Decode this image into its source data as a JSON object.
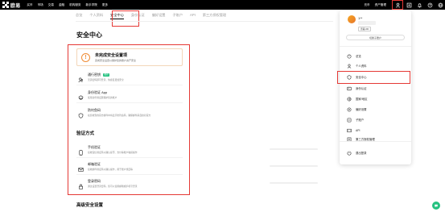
{
  "app": {
    "logo_text": "欧易",
    "nav": [
      "买币",
      "市场",
      "交易",
      "金融",
      "机构服务",
      "新手学院",
      "更多"
    ],
    "nav_right": [
      "充币",
      "资产管理"
    ]
  },
  "tabs": [
    "总览",
    "个人资料",
    "安全中心",
    "身份认证",
    "偏好设置",
    "子账户",
    "API",
    "第三方授权管理"
  ],
  "page_title": "安全中心",
  "warning": {
    "title": "未完成安全设置项",
    "desc": "完成安全设置以保护您的账户资产安全"
  },
  "security_items": [
    {
      "name": "通行密钥",
      "badge": "推荐",
      "desc": "无需密码即可登录，快捷且更加安全"
    },
    {
      "name": "身份验证 App",
      "badge": "",
      "desc": "使用身份验证器保护您的账户"
    },
    {
      "name": "防钓鱼码",
      "badge": "",
      "desc": "在您收到的官方邮件中将显示防钓鱼码，确保邮件来自欧易官方"
    }
  ],
  "verify_title": "验证方式",
  "verify_items": [
    {
      "name": "手机验证",
      "desc": "接收短信验证码以确认提币、支付等账户敏感操作"
    },
    {
      "name": "邮箱验证",
      "desc": "接收邮件验证码以确认操作，用于账户找回等"
    },
    {
      "name": "登录密码",
      "desc": "通过设置登录密码，您可以使用邮箱或手机号登录"
    }
  ],
  "advanced_title": "高级安全设置",
  "dropdown": {
    "name": "1**",
    "tag": "查看UID",
    "button": "切换子账户",
    "items": [
      {
        "icon": "overview-icon",
        "label": "总览"
      },
      {
        "icon": "profile-icon",
        "label": "个人资料"
      },
      {
        "icon": "shield-icon",
        "label": "安全中心"
      },
      {
        "icon": "id-card-icon",
        "label": "身份认证"
      },
      {
        "icon": "globe-icon",
        "label": "国家/地区"
      },
      {
        "icon": "preferences-icon",
        "label": "偏好设置"
      },
      {
        "icon": "sub-account-icon",
        "label": "子账户"
      },
      {
        "icon": "api-icon",
        "label": "API"
      },
      {
        "icon": "third-party-icon",
        "label": "第三方授权管理"
      },
      {
        "icon": "logout-icon",
        "label": "退出登录"
      }
    ]
  },
  "colors": {
    "highlight": "#e53935",
    "warning": "#f08c34",
    "badge": "#26c281"
  }
}
